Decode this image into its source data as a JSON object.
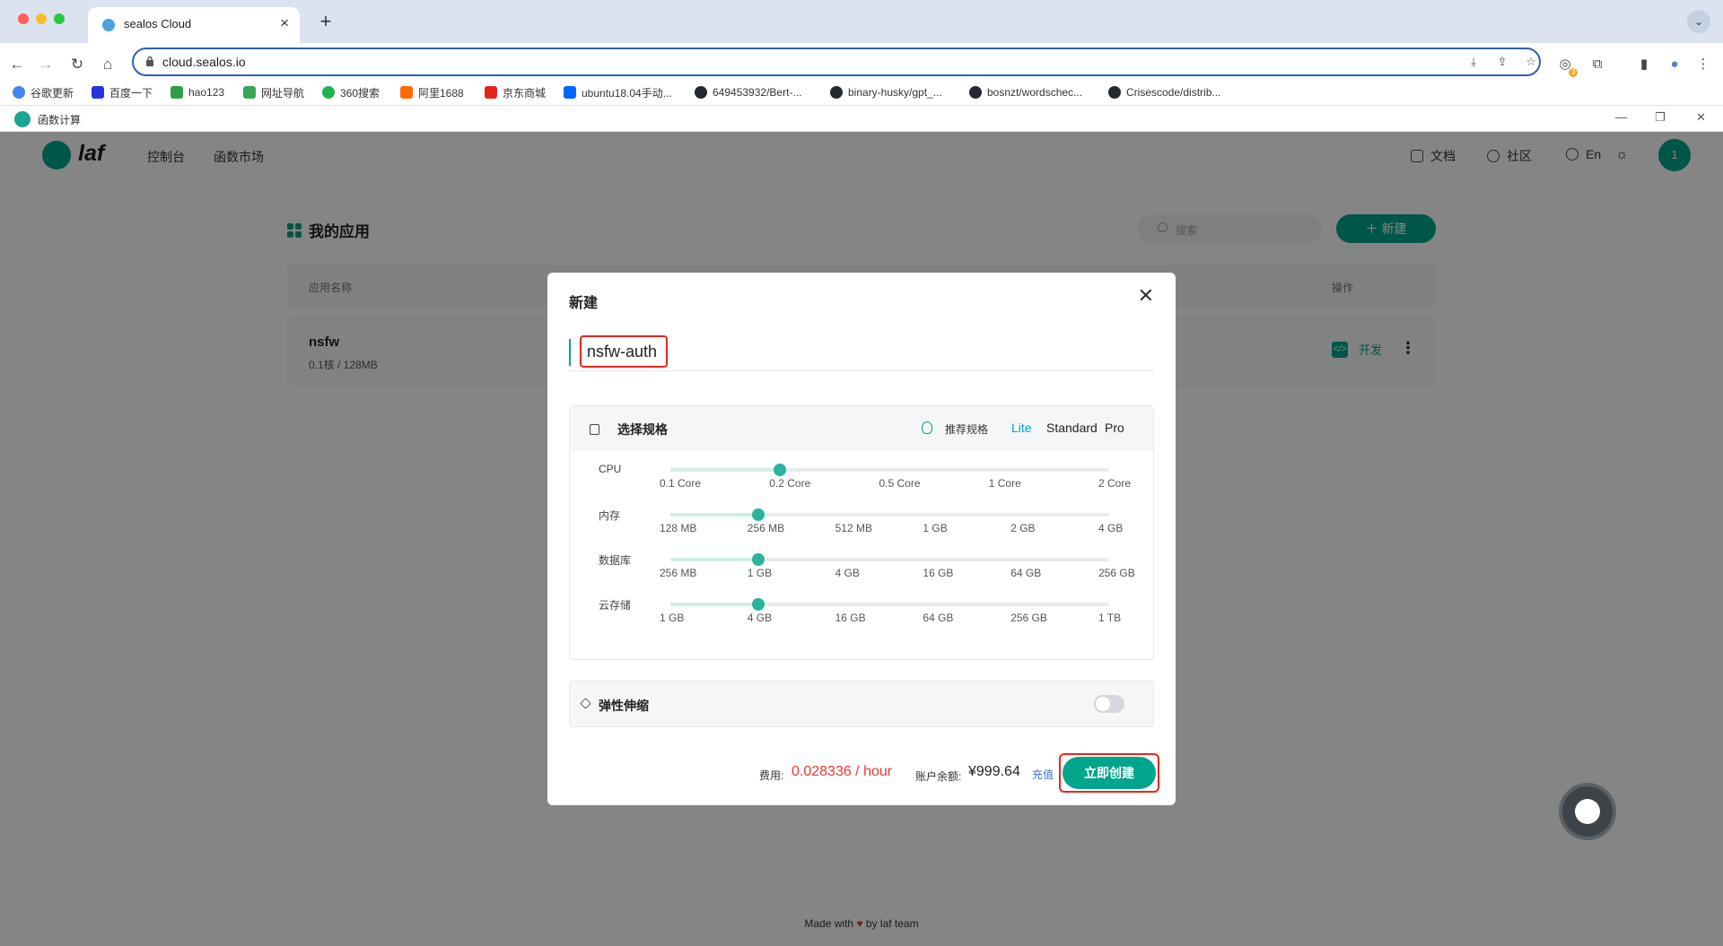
{
  "browser": {
    "tab_title": "sealos Cloud",
    "url": "cloud.sealos.io",
    "extension_badge": "3",
    "bookmarks": [
      {
        "label": "谷歌更新",
        "color": "#4285f4"
      },
      {
        "label": "百度一下",
        "color": "#2932e1"
      },
      {
        "label": "hao123",
        "color": "#2f9e44"
      },
      {
        "label": "网址导航",
        "color": "#3aa757"
      },
      {
        "label": "360搜索",
        "color": "#22b14c"
      },
      {
        "label": "阿里1688",
        "color": "#ff6a00"
      },
      {
        "label": "京东商城",
        "color": "#e1251b"
      },
      {
        "label": "ubuntu18.04手动...",
        "color": "#0066ff"
      },
      {
        "label": "649453932/Bert-...",
        "color": "#24292f"
      },
      {
        "label": "binary-husky/gpt_...",
        "color": "#24292f"
      },
      {
        "label": "bosnzt/wordschec...",
        "color": "#24292f"
      },
      {
        "label": "Crisescode/distrib...",
        "color": "#24292f"
      }
    ]
  },
  "app_window": {
    "title": "函数计算"
  },
  "header": {
    "logo_text": "laf",
    "nav": [
      "控制台",
      "函数市场"
    ],
    "docs": "文档",
    "community": "社区",
    "language": "En",
    "avatar": "1"
  },
  "apps_page": {
    "title": "我的应用",
    "search_placeholder": "搜索",
    "new_button": "新建",
    "col_name": "应用名称",
    "col_actions": "操作",
    "row": {
      "name": "nsfw",
      "spec": "0.1核 / 128MB",
      "dev": "开发"
    },
    "footer_before": "Made with",
    "footer_after": "by laf team"
  },
  "modal": {
    "title": "新建",
    "app_name_value": "nsfw-auth",
    "spec_title": "选择规格",
    "recommend_label": "推荐规格",
    "tiers": [
      "Lite",
      "Standard",
      "Pro"
    ],
    "active_tier": "Lite",
    "sliders": [
      {
        "label": "CPU",
        "ticks": [
          "0.1 Core",
          "0.2 Core",
          "0.5 Core",
          "1 Core",
          "2 Core"
        ],
        "selected_index": 1
      },
      {
        "label": "内存",
        "ticks": [
          "128 MB",
          "256 MB",
          "512 MB",
          "1 GB",
          "2 GB",
          "4 GB"
        ],
        "selected_index": 1
      },
      {
        "label": "数据库",
        "ticks": [
          "256 MB",
          "1 GB",
          "4 GB",
          "16 GB",
          "64 GB",
          "256 GB"
        ],
        "selected_index": 1
      },
      {
        "label": "云存储",
        "ticks": [
          "1 GB",
          "4 GB",
          "16 GB",
          "64 GB",
          "256 GB",
          "1 TB"
        ],
        "selected_index": 1
      }
    ],
    "elastic_title": "弹性伸缩",
    "elastic_enabled": false,
    "fee_label": "费用:",
    "fee_value": "0.028336 / hour",
    "balance_label": "账户余额:",
    "balance_value": "¥999.64",
    "recharge": "充值",
    "create_button": "立即创建",
    "accent_color": "#00a58b",
    "highlight_color": "#e8261b"
  }
}
